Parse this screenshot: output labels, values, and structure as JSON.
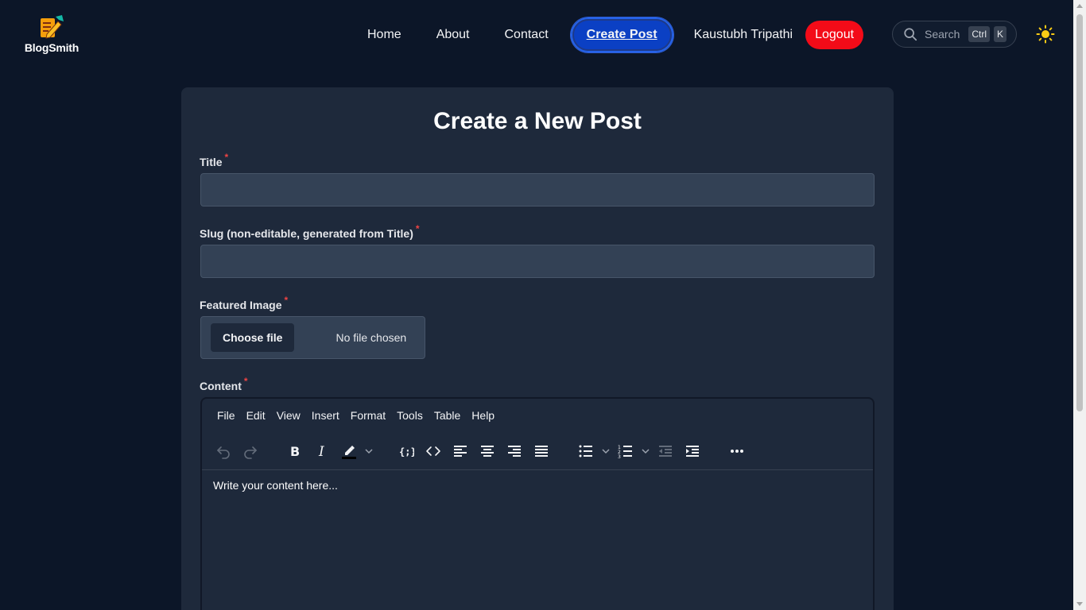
{
  "brand": {
    "name": "BlogSmith"
  },
  "nav": {
    "home": "Home",
    "about": "About",
    "contact": "Contact",
    "create_post": "Create Post",
    "user": "Kaustubh Tripathi",
    "logout": "Logout"
  },
  "search": {
    "label": "Search",
    "key_ctrl": "Ctrl",
    "key_k": "K"
  },
  "form": {
    "heading": "Create a New Post",
    "title_label": "Title",
    "title_value": "",
    "slug_label": "Slug (non-editable, generated from Title)",
    "slug_value": "",
    "image_label": "Featured Image",
    "choose_file": "Choose file",
    "no_file": "No file chosen",
    "content_label": "Content",
    "required_mark": "*"
  },
  "editor": {
    "menus": [
      "File",
      "Edit",
      "View",
      "Insert",
      "Format",
      "Tools",
      "Table",
      "Help"
    ],
    "placeholder": "Write your content here..."
  },
  "colors": {
    "background": "#0c1628",
    "card": "#1e293b",
    "active_nav": "#0b40c4",
    "logout": "#f30b18",
    "required": "#ef4444",
    "sun": "#facc15"
  }
}
